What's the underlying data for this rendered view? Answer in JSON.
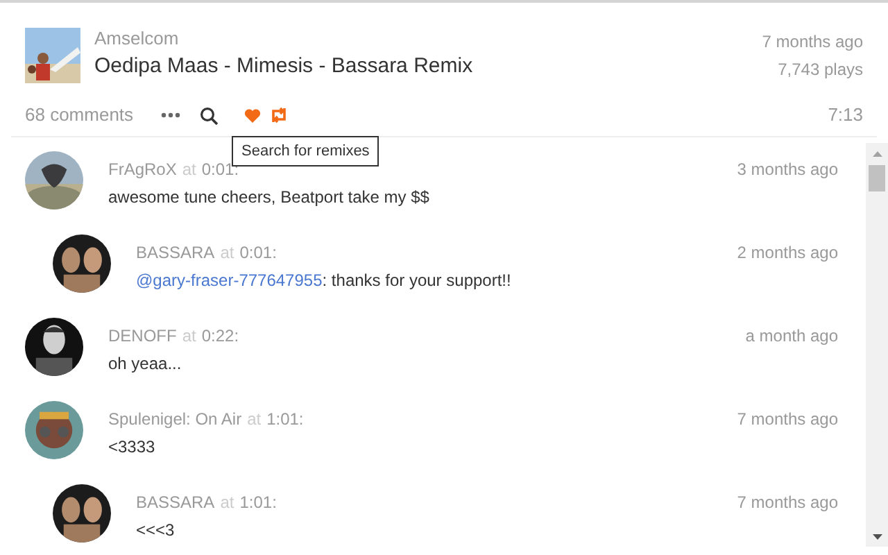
{
  "track": {
    "kind": "picture",
    "uploader": "Amselcom",
    "title": "Oedipa Maas - Mimesis - Bassara Remix",
    "age": "7 months ago",
    "plays": "7,743 plays"
  },
  "actions": {
    "comments": "68 comments",
    "liked": true,
    "reposted": true,
    "duration": "7:13"
  },
  "tooltip": "Search for remixes",
  "comments": [
    {
      "user": "FrAgRoX",
      "at": "at",
      "time": "0:01:",
      "age": "3 months ago",
      "text": "awesome tune cheers, Beatport take my $$",
      "children": [
        {
          "user": "BASSARA",
          "at": "at",
          "time": "0:01:",
          "age": "2 months ago",
          "mention": "@gary-fraser-777647955",
          "text": ": thanks for your support!!"
        }
      ]
    },
    {
      "user": "DENOFF",
      "at": "at",
      "time": "0:22:",
      "age": "a month ago",
      "text": "oh yeaa..."
    },
    {
      "user": "Spulenigel: On Air",
      "at": "at",
      "time": "1:01:",
      "age": "7 months ago",
      "text": "<3333",
      "children": [
        {
          "user": "BASSARA",
          "at": "at",
          "time": "1:01:",
          "age": "7 months ago",
          "text": "<<<3"
        }
      ]
    }
  ]
}
